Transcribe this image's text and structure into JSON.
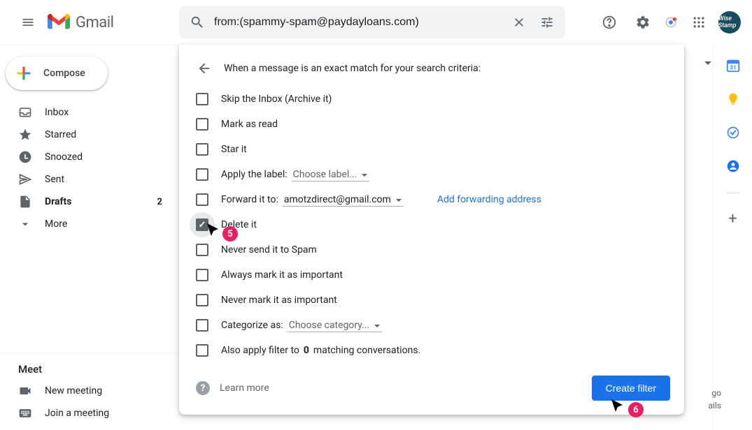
{
  "header": {
    "logo_text": "Gmail",
    "search_value": "from:(spammy-spam@paydayloans.com)",
    "avatar_text": "Wise Stamp"
  },
  "compose": {
    "label": "Compose"
  },
  "nav": [
    {
      "icon": "inbox",
      "label": "Inbox",
      "count": "",
      "bold": false
    },
    {
      "icon": "star",
      "label": "Starred",
      "count": "",
      "bold": false
    },
    {
      "icon": "clock",
      "label": "Snoozed",
      "count": "",
      "bold": false
    },
    {
      "icon": "send",
      "label": "Sent",
      "count": "",
      "bold": false
    },
    {
      "icon": "file",
      "label": "Drafts",
      "count": "2",
      "bold": true
    },
    {
      "icon": "chevron-down",
      "label": "More",
      "count": "",
      "bold": false
    }
  ],
  "meet": {
    "header": "Meet",
    "items": [
      {
        "icon": "video",
        "label": "New meeting"
      },
      {
        "icon": "keyboard",
        "label": "Join a meeting"
      }
    ]
  },
  "filter": {
    "title": "When a message is an exact match for your search criteria:",
    "options": {
      "skip_inbox": "Skip the Inbox (Archive it)",
      "mark_read": "Mark as read",
      "star_it": "Star it",
      "apply_label_prefix": "Apply the label:",
      "apply_label_value": "Choose label...",
      "forward_prefix": "Forward it to:",
      "forward_value": "amotzdirect@gmail.com",
      "forward_link": "Add forwarding address",
      "delete_it": "Delete it",
      "never_spam": "Never send it to Spam",
      "always_important": "Always mark it as important",
      "never_important": "Never mark it as important",
      "categorize_prefix": "Categorize as:",
      "categorize_value": "Choose category...",
      "also_apply_pre": "Also apply filter to ",
      "also_apply_count": "0",
      "also_apply_post": " matching conversations."
    },
    "learn_more": "Learn more",
    "create_btn": "Create filter"
  },
  "behind": {
    "line1": "go",
    "line2": "ails"
  },
  "annotations": {
    "badge5": "5",
    "badge6": "6"
  }
}
